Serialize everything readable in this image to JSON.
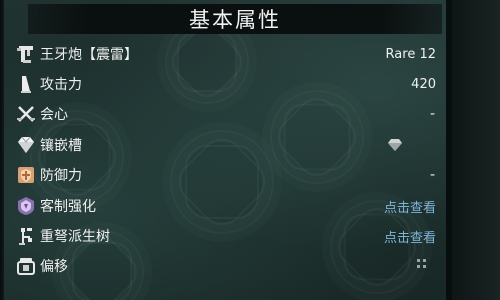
{
  "panel": {
    "title": "基本属性"
  },
  "rows": [
    {
      "icon": "heavy-bowgun-icon",
      "label": "王牙炮【震雷】",
      "value": "Rare 12"
    },
    {
      "icon": "attack-blade-icon",
      "label": "攻击力",
      "value": "420"
    },
    {
      "icon": "affinity-swords-icon",
      "label": "会心",
      "value": "-"
    },
    {
      "icon": "decoration-gem-icon",
      "label": "镶嵌槽",
      "value": ""
    },
    {
      "icon": "defense-shield-icon",
      "label": "防御力",
      "value": "-"
    },
    {
      "icon": "rampage-skill-icon",
      "label": "客制强化",
      "value": "点击查看"
    },
    {
      "icon": "weapon-tree-icon",
      "label": "重弩派生树",
      "value": "点击查看"
    },
    {
      "icon": "deviation-scope-icon",
      "label": "偏移",
      "value": ""
    }
  ],
  "slots": {
    "icon": "gem-slot-icon"
  },
  "colors": {
    "text": "#f0f0f0",
    "link": "#7fb5d8",
    "title_bar": "#0a0f0f",
    "background": "#1c2e2c"
  }
}
